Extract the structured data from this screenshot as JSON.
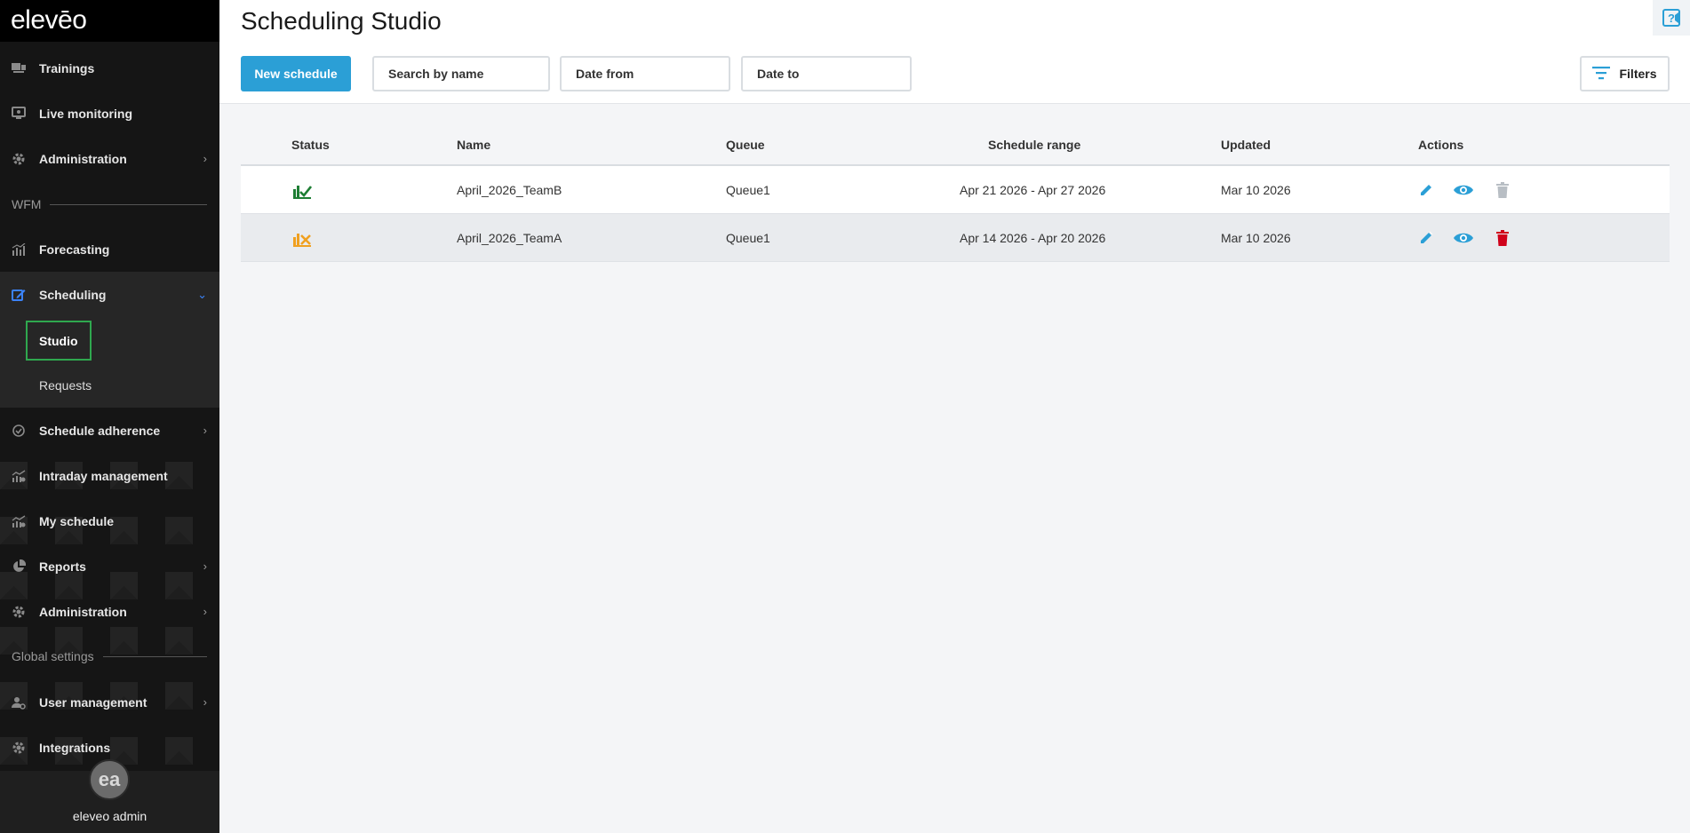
{
  "app": {
    "logo_text": "elevēo",
    "page_title": "Scheduling Studio",
    "accent_color": "#2b9fd6",
    "success_color": "#1e7e34",
    "warning_color": "#f0a020",
    "danger_color": "#d0021b"
  },
  "sidebar": {
    "items": [
      {
        "label": "Trainings",
        "icon": "trainings-icon"
      },
      {
        "label": "Live monitoring",
        "icon": "monitor-icon"
      },
      {
        "label": "Administration",
        "icon": "gear-icon"
      },
      {
        "label": "Forecasting",
        "icon": "chart-icon"
      },
      {
        "label": "Scheduling",
        "icon": "edit-calendar-icon"
      },
      {
        "label": "Schedule adherence",
        "icon": "check-circle-icon"
      },
      {
        "label": "Intraday management",
        "icon": "trend-icon"
      },
      {
        "label": "My schedule",
        "icon": "trend-icon"
      },
      {
        "label": "Reports",
        "icon": "pie-icon"
      },
      {
        "label": "Administration",
        "icon": "gear-icon"
      },
      {
        "label": "User management",
        "icon": "user-gear-icon"
      },
      {
        "label": "Integrations",
        "icon": "gear-icon"
      }
    ],
    "section_wfm": "WFM",
    "section_global": "Global settings",
    "sub_studio": "Studio",
    "sub_requests": "Requests",
    "user_initials": "ea",
    "user_name": "eleveo admin"
  },
  "toolbar": {
    "new_schedule_label": "New schedule",
    "search_placeholder": "Search by name",
    "date_from_placeholder": "Date from",
    "date_to_placeholder": "Date to",
    "filters_label": "Filters"
  },
  "table": {
    "columns": [
      "Status",
      "Name",
      "Queue",
      "Schedule range",
      "Updated",
      "Actions"
    ],
    "rows": [
      {
        "status": "published",
        "name": "April_2026_TeamB",
        "queue": "Queue1",
        "range": "Apr 21 2026 - Apr 27 2026",
        "updated": "Mar 10 2026",
        "delete_enabled": false
      },
      {
        "status": "draft",
        "name": "April_2026_TeamA",
        "queue": "Queue1",
        "range": "Apr 14 2026 - Apr 20 2026",
        "updated": "Mar 10 2026",
        "delete_enabled": true
      }
    ]
  }
}
